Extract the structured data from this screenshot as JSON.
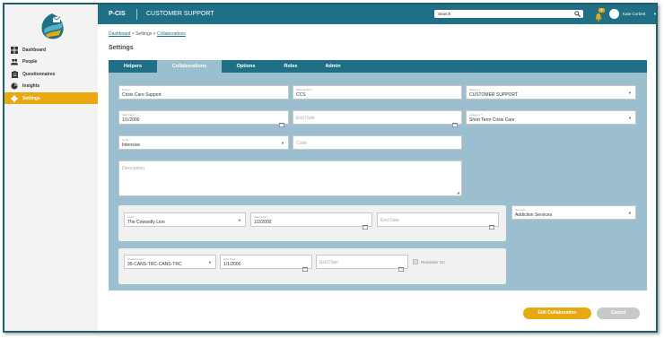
{
  "header": {
    "app_name": "P-CIS",
    "module_name": "CUSTOMER SUPPORT",
    "search_placeholder": "Search",
    "notification_count": "4",
    "user_name": "Kate Corbett"
  },
  "sidebar": {
    "items": [
      {
        "label": "Dashboard",
        "icon": "dashboard-icon"
      },
      {
        "label": "People",
        "icon": "people-icon"
      },
      {
        "label": "Questionnaires",
        "icon": "clipboard-icon"
      },
      {
        "label": "Insights",
        "icon": "pie-chart-icon"
      },
      {
        "label": "Settings",
        "icon": "gear-icon",
        "active": true
      }
    ]
  },
  "breadcrumb": {
    "dashboard": "Dashboard",
    "sep1": " > ",
    "settings": "Settings",
    "sep2": " > ",
    "collaborations": "Collaborations"
  },
  "page_title": "Settings",
  "tabs": [
    {
      "label": "Helpers"
    },
    {
      "label": "Collaborations",
      "active": true
    },
    {
      "label": "Options"
    },
    {
      "label": "Roles"
    },
    {
      "label": "Admin"
    }
  ],
  "form": {
    "name": {
      "label": "Name *",
      "value": "Crisis Care Support"
    },
    "abbreviation": {
      "label": "Abbreviation *",
      "value": "CCS"
    },
    "agency": {
      "label": "Agency *",
      "value": "CUSTOMER SUPPORT"
    },
    "start_date": {
      "label": "Start Date *",
      "value": "1/1/2000"
    },
    "end_date": {
      "placeholder": "End Date"
    },
    "category": {
      "label": "Category *",
      "value": "Short Term Crisis Care"
    },
    "level": {
      "label": "Level *",
      "value": "Intensive"
    },
    "code": {
      "placeholder": "Code"
    },
    "description": {
      "placeholder": "Description"
    },
    "lead": {
      "label": "Lead *",
      "value": "The Cowardly Lion"
    },
    "lead_start": {
      "label": "Start Date *",
      "value": "1/2/2000"
    },
    "lead_end": {
      "placeholder": "End Date"
    },
    "services": {
      "label": "Services",
      "value": "Addiction Services"
    },
    "questionnaire": {
      "label": "Questionnaire *",
      "value": "95-CANS-TRC-CANS-TRC"
    },
    "q_start": {
      "label": "Start Date *",
      "value": "1/1/2000"
    },
    "q_end": {
      "placeholder": "End Date"
    },
    "reminder": {
      "label": "Reminder On"
    }
  },
  "buttons": {
    "edit": "Edit Collaboration",
    "cancel": "Cancel"
  },
  "colors": {
    "header": "#1f6f86",
    "accent": "#e8a812",
    "panel": "#9bbfcf"
  }
}
